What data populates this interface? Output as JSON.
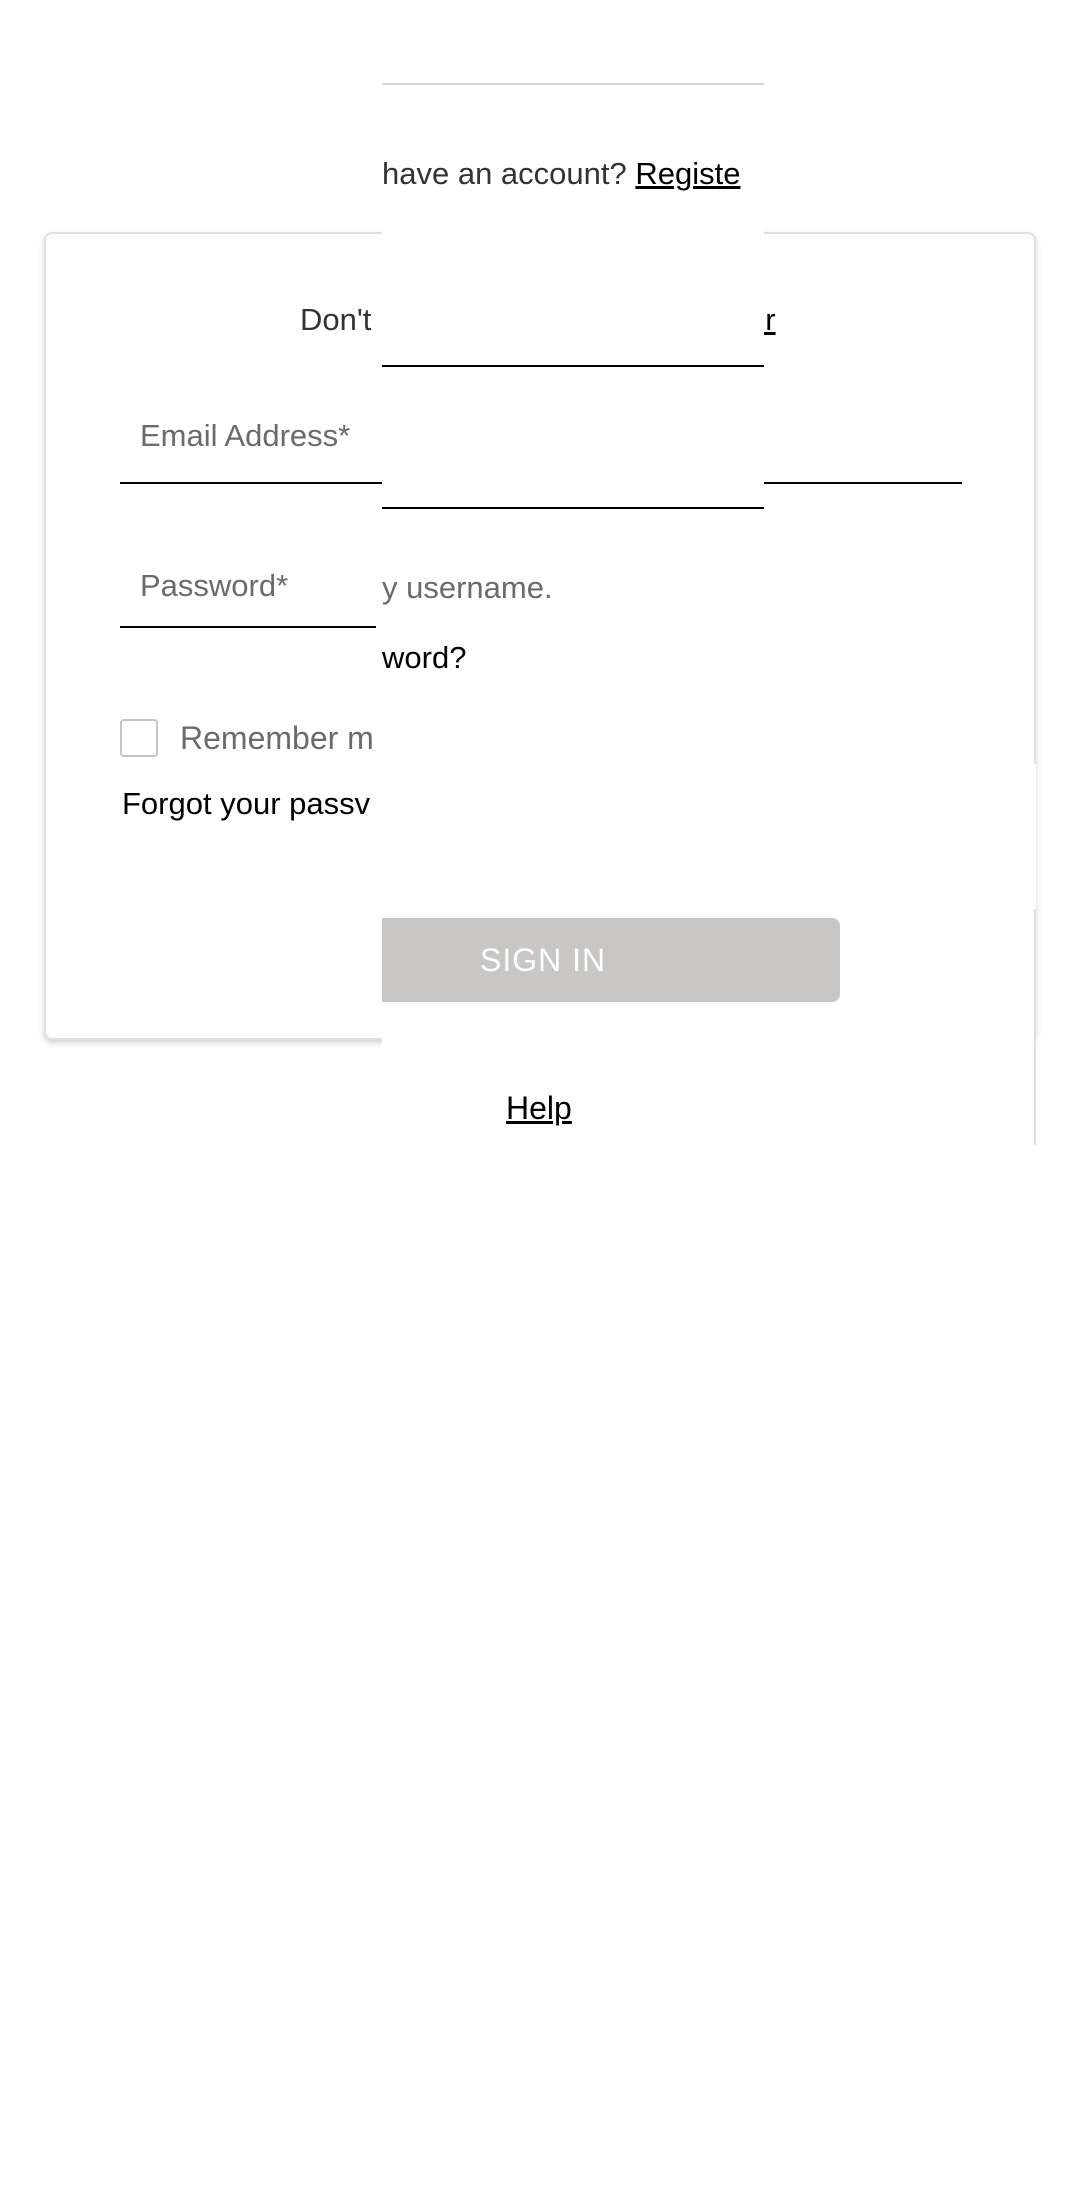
{
  "base_card": {
    "register_prefix": "Don't",
    "email_label": "Email Address*",
    "password_label": "Password*",
    "remember_label": "Remember m",
    "forgot_link": "Forgot your passv"
  },
  "overlay": {
    "register_prompt": "have an account?",
    "register_link": "Registe",
    "register_link_tail": "er",
    "username_hint": "y username.",
    "forgot_tail": "word?",
    "signin_button": "SIGN IN",
    "help_link": "Help"
  },
  "colors": {
    "button_bg": "#c8c7c6",
    "button_text": "#ffffff",
    "label_text": "#6b6b6b",
    "card_border": "#e0e0e0"
  }
}
